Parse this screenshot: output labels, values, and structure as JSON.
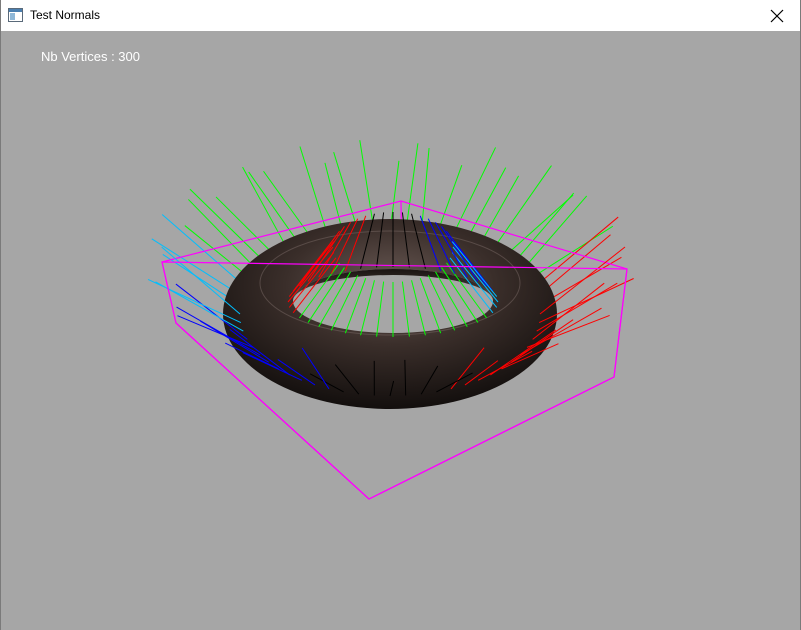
{
  "window": {
    "title": "Test Normals",
    "close_symbol": "✕",
    "app_icon": "window-app-icon"
  },
  "viewport": {
    "background_color": "#a6a6a6",
    "overlay_label": "Nb Vertices : 300"
  },
  "scene": {
    "object": "torus",
    "torus_color": "#2e2421",
    "bounding_box_color": "#ff00ff",
    "normal_colors": [
      "#00ff00",
      "#0000ff",
      "#ff0000",
      "#ffff00",
      "#00bfff",
      "#000000"
    ]
  }
}
